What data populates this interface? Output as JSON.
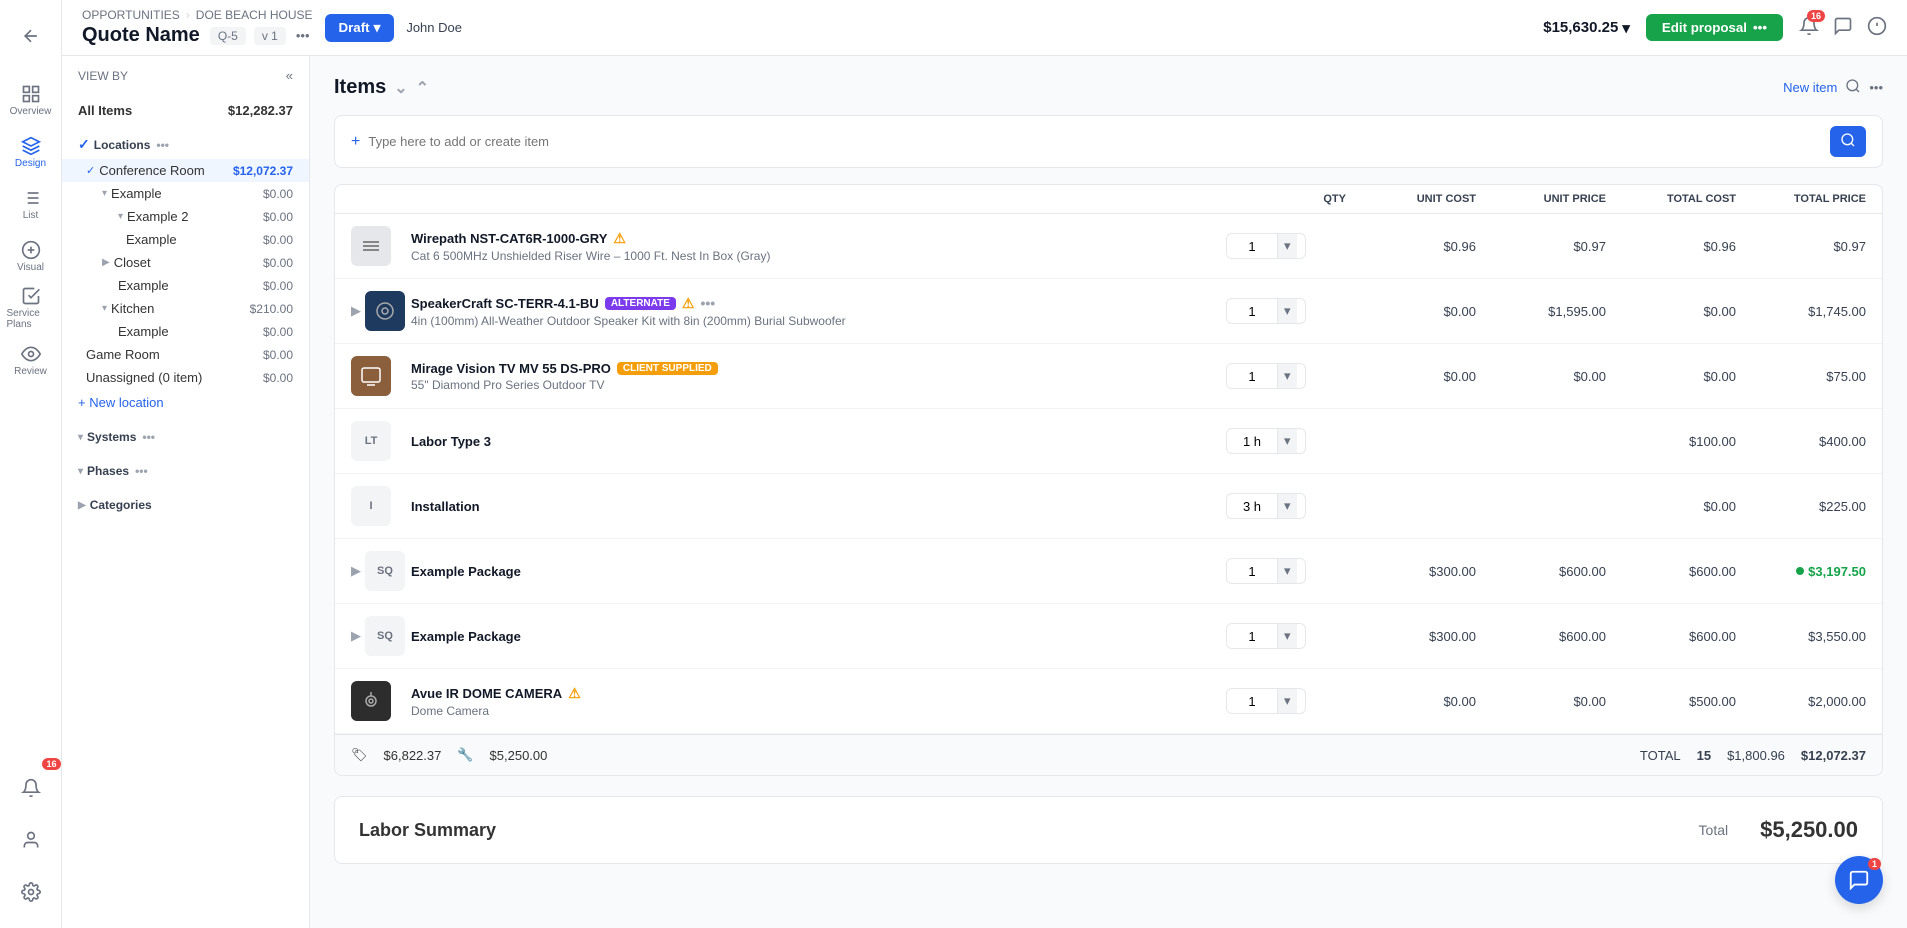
{
  "topbar": {
    "breadcrumb": [
      "OPPORTUNITIES",
      "DOE BEACH HOUSE"
    ],
    "title": "Quote Name",
    "meta": {
      "q": "Q-5",
      "v": "v 1"
    },
    "status": "Draft",
    "user": "John Doe",
    "price": "$15,630.25",
    "edit_proposal": "Edit proposal"
  },
  "nav": {
    "items": [
      {
        "id": "overview",
        "label": "Overview",
        "icon": "grid"
      },
      {
        "id": "design",
        "label": "Design",
        "icon": "design",
        "active": true
      },
      {
        "id": "list",
        "label": "List",
        "icon": "list"
      },
      {
        "id": "visual",
        "label": "Visual",
        "icon": "visual"
      },
      {
        "id": "service-plans",
        "label": "Service Plans",
        "icon": "plans"
      },
      {
        "id": "review",
        "label": "Review",
        "icon": "review"
      }
    ],
    "bottom": [
      {
        "id": "notifications",
        "icon": "bell",
        "badge": ""
      },
      {
        "id": "add-user",
        "icon": "add-user"
      },
      {
        "id": "settings",
        "icon": "settings"
      }
    ]
  },
  "sidebar": {
    "view_by": "VIEW BY",
    "all_items_label": "All Items",
    "all_items_amount": "$12,282.37",
    "sections": {
      "locations": {
        "label": "Locations",
        "expanded": true,
        "items": [
          {
            "label": "Conference Room",
            "amount": "$12,072.37",
            "active": true,
            "level": 1,
            "children": [
              {
                "label": "Example",
                "amount": "$0.00",
                "level": 2,
                "children": [
                  {
                    "label": "Example 2",
                    "amount": "$0.00",
                    "level": 3,
                    "children": [
                      {
                        "label": "Example",
                        "amount": "$0.00",
                        "level": 4
                      }
                    ]
                  }
                ]
              },
              {
                "label": "Closet",
                "amount": "$0.00",
                "level": 2,
                "children": [
                  {
                    "label": "Example",
                    "amount": "$0.00",
                    "level": 3
                  }
                ]
              },
              {
                "label": "Kitchen",
                "amount": "$210.00",
                "level": 2,
                "children": [
                  {
                    "label": "Example",
                    "amount": "$0.00",
                    "level": 3
                  }
                ]
              }
            ]
          },
          {
            "label": "Game Room",
            "amount": "$0.00",
            "level": 1
          },
          {
            "label": "Unassigned (0 item)",
            "amount": "$0.00",
            "level": 1
          }
        ],
        "new_location": "+ New location"
      },
      "systems": {
        "label": "Systems",
        "expanded": true
      },
      "phases": {
        "label": "Phases",
        "expanded": true
      },
      "categories": {
        "label": "Categories",
        "expanded": false
      }
    }
  },
  "items": {
    "title": "Items",
    "new_item_label": "New item",
    "add_placeholder": "Type here to add or create item",
    "columns": {
      "qty": "QTY",
      "unit_cost": "UNIT COST",
      "unit_price": "UNIT PRICE",
      "total_cost": "TOTAL COST",
      "total_price": "TOTAL PRICE"
    },
    "rows": [
      {
        "id": 1,
        "icon_type": "image",
        "icon_bg": "#e5e7eb",
        "name": "Wirepath NST-CAT6R-1000-GRY",
        "has_warning": true,
        "description": "Cat 6 500MHz Unshielded Riser Wire – 1000 Ft. Nest In Box (Gray)",
        "badge": null,
        "qty": "1",
        "unit_cost": "$0.96",
        "unit_price": "$0.97",
        "total_cost": "$0.96",
        "total_price": "$0.97"
      },
      {
        "id": 2,
        "icon_type": "image",
        "icon_bg": "#1e3a5f",
        "name": "SpeakerCraft SC-TERR-4.1-BU",
        "badge": "ALTERNATE",
        "has_warning": true,
        "has_dots": true,
        "description": "4in (100mm) All-Weather Outdoor Speaker Kit with 8in (200mm) Burial Subwoofer",
        "qty": "1",
        "unit_cost": "$0.00",
        "unit_price": "$1,595.00",
        "total_cost": "$0.00",
        "total_price": "$1,745.00",
        "expandable": true
      },
      {
        "id": 3,
        "icon_type": "image",
        "icon_bg": "#8b5e3c",
        "name": "Mirage Vision TV MV 55 DS-PRO",
        "badge": "CLIENT SUPPLIED",
        "badge_type": "client",
        "has_warning": false,
        "description": "55\" Diamond Pro Series Outdoor TV",
        "qty": "1",
        "unit_cost": "$0.00",
        "unit_price": "$0.00",
        "total_cost": "$0.00",
        "total_price": "$75.00"
      },
      {
        "id": 4,
        "icon_type": "text",
        "icon_text": "LT",
        "name": "Labor Type 3",
        "badge": null,
        "has_warning": false,
        "description": "",
        "qty": "1 h",
        "unit_cost": "",
        "unit_price": "",
        "total_cost": "$100.00",
        "total_price": "$400.00"
      },
      {
        "id": 5,
        "icon_type": "text",
        "icon_text": "I",
        "name": "Installation",
        "badge": null,
        "has_warning": false,
        "description": "",
        "qty": "3 h",
        "unit_cost": "",
        "unit_price": "",
        "total_cost": "$0.00",
        "total_price": "$225.00"
      },
      {
        "id": 6,
        "icon_type": "text",
        "icon_text": "SQ",
        "name": "Example Package",
        "badge": null,
        "has_warning": false,
        "description": "",
        "qty": "1",
        "unit_cost": "$300.00",
        "unit_price": "$600.00",
        "total_cost": "$600.00",
        "total_price": "$3,197.50",
        "total_price_green": true,
        "expandable": true
      },
      {
        "id": 7,
        "icon_type": "text",
        "icon_text": "SQ",
        "name": "Example Package",
        "badge": null,
        "has_warning": false,
        "description": "",
        "qty": "1",
        "unit_cost": "$300.00",
        "unit_price": "$600.00",
        "total_cost": "$600.00",
        "total_price": "$3,550.00",
        "expandable": true
      },
      {
        "id": 8,
        "icon_type": "image",
        "icon_bg": "#2d2d2d",
        "name": "Avue IR DOME CAMERA",
        "has_warning": true,
        "description": "Dome Camera",
        "badge": null,
        "qty": "1",
        "unit_cost": "$0.00",
        "unit_price": "$0.00",
        "total_cost": "$500.00",
        "total_price": "$2,000.00"
      }
    ],
    "footer": {
      "cost_icon": "💰",
      "cost": "$6,822.37",
      "labor_icon": "🔧",
      "labor": "$5,250.00",
      "total_label": "TOTAL",
      "count": "15",
      "total_cost": "$1,800.96",
      "total_price": "$12,072.37"
    }
  },
  "labor_summary": {
    "title": "Labor Summary",
    "total_label": "Total",
    "amount": "$5,250.00"
  },
  "notifications_badge": "16"
}
